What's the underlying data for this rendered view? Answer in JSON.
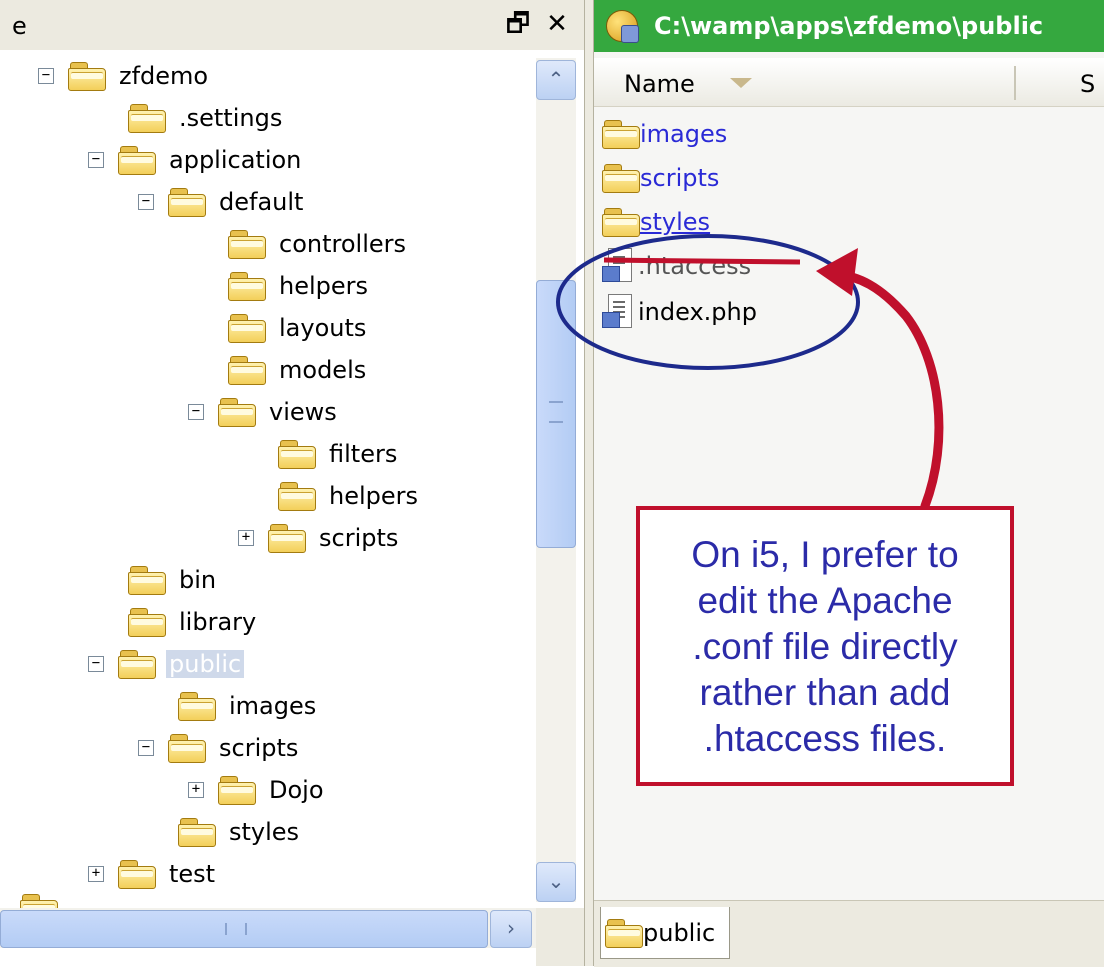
{
  "tree": {
    "title_fragment": "e",
    "pin_glyph": "🗗",
    "close_glyph": "✕",
    "nodes": [
      {
        "label": "zfdemo",
        "expander": "−"
      },
      {
        "label": ".settings",
        "expander": ""
      },
      {
        "label": "application",
        "expander": "−"
      },
      {
        "label": "default",
        "expander": "−"
      },
      {
        "label": "controllers",
        "expander": ""
      },
      {
        "label": "helpers",
        "expander": ""
      },
      {
        "label": "layouts",
        "expander": ""
      },
      {
        "label": "models",
        "expander": ""
      },
      {
        "label": "views",
        "expander": "−"
      },
      {
        "label": "filters",
        "expander": ""
      },
      {
        "label": "helpers",
        "expander": ""
      },
      {
        "label": "scripts",
        "expander": "+"
      },
      {
        "label": "bin",
        "expander": ""
      },
      {
        "label": "library",
        "expander": ""
      },
      {
        "label": "public",
        "expander": "−",
        "selected": true
      },
      {
        "label": "images",
        "expander": ""
      },
      {
        "label": "scripts",
        "expander": "−"
      },
      {
        "label": "Dojo",
        "expander": "+"
      },
      {
        "label": "styles",
        "expander": ""
      },
      {
        "label": "test",
        "expander": "+"
      }
    ],
    "scroll_up": "⌃",
    "scroll_down": "⌄",
    "scroll_right": "›"
  },
  "explorer": {
    "path": "C:\\wamp\\apps\\zfdemo\\public",
    "column_name": "Name",
    "column_next": "S",
    "items": [
      {
        "label": "images",
        "icon": "folder-icon"
      },
      {
        "label": "scripts",
        "icon": "folder-icon"
      },
      {
        "label": "styles",
        "icon": "folder-icon"
      },
      {
        "label": ".htaccess",
        "icon": "file-icon"
      },
      {
        "label": "index.php",
        "icon": "php-file-icon"
      }
    ],
    "tab_label": "public"
  },
  "annotation": {
    "callout_lines": [
      "On i5, I prefer to",
      "edit the Apache",
      ".conf file directly",
      "rather than add",
      ".htaccess files."
    ],
    "arrow_color": "#c0102c",
    "circle_color": "#1d2a8c"
  }
}
